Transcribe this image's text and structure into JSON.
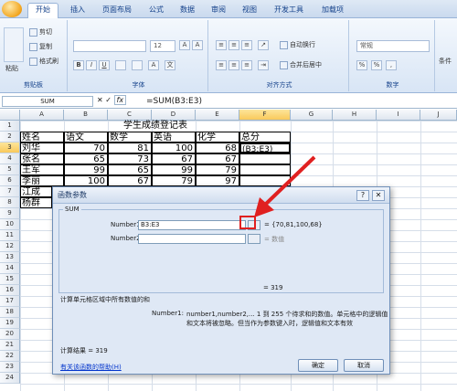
{
  "ribbon": {
    "tabs": [
      "开始",
      "插入",
      "页面布局",
      "公式",
      "数据",
      "审阅",
      "视图",
      "开发工具",
      "加载项"
    ],
    "clipboard": {
      "cut": "剪切",
      "copy": "复制",
      "format_painter": "格式刷",
      "paste": "粘贴",
      "label": "剪贴板"
    },
    "font": {
      "size": "12",
      "label": "字体"
    },
    "alignment": {
      "wrap": "自动换行",
      "merge": "合并后居中",
      "label": "对齐方式"
    },
    "number": {
      "format": "常规",
      "label": "数字"
    },
    "styles": {
      "label": "条件"
    }
  },
  "formula_bar": {
    "name_box": "SUM",
    "formula": "=SUM(B3:E3)"
  },
  "columns": [
    "A",
    "B",
    "C",
    "D",
    "E",
    "F",
    "G",
    "H",
    "I",
    "J"
  ],
  "rows": [
    "1",
    "2",
    "3",
    "4",
    "5",
    "6",
    "7",
    "8",
    "9",
    "10",
    "11",
    "12",
    "13",
    "14",
    "15",
    "16",
    "17",
    "18",
    "19",
    "20",
    "21",
    "22",
    "23",
    "24"
  ],
  "sheet": {
    "title": "学生成绩登记表",
    "headers": [
      "姓名",
      "语文",
      "数学",
      "英语",
      "化学",
      "总分"
    ],
    "data": [
      [
        "刘华",
        "70",
        "81",
        "100",
        "68",
        "(B3:E3)"
      ],
      [
        "张名",
        "65",
        "73",
        "67",
        "67",
        ""
      ],
      [
        "王军",
        "99",
        "65",
        "99",
        "79",
        ""
      ],
      [
        "李丽",
        "100",
        "67",
        "79",
        "97",
        ""
      ],
      [
        "江成",
        "",
        "",
        "",
        "",
        ""
      ],
      [
        "杨群",
        "",
        "",
        "",
        "",
        ""
      ]
    ]
  },
  "dialog": {
    "title": "函数参数",
    "function_name": "SUM",
    "arg1_label": "Number1",
    "arg1_value": "B3:E3",
    "arg1_result": "= {70,81,100,68}",
    "arg2_label": "Number2",
    "arg2_result": "= 数值",
    "total": "= 319",
    "description": "计算单元格区域中所有数值的和",
    "arg_help_name": "Number1:",
    "arg_help_line1": "number1,number2,... 1 到 255 个待求和的数值。单元格中的逻辑值",
    "arg_help_line2": "和文本将被忽略。但当作为参数键入时，逻辑值和文本有效",
    "result": "计算结果 = 319",
    "help_link": "有关该函数的帮助(H)",
    "ok": "确定",
    "cancel": "取消"
  },
  "colors": {
    "annotation": "#e02020",
    "active_col": "#f9c95b"
  }
}
